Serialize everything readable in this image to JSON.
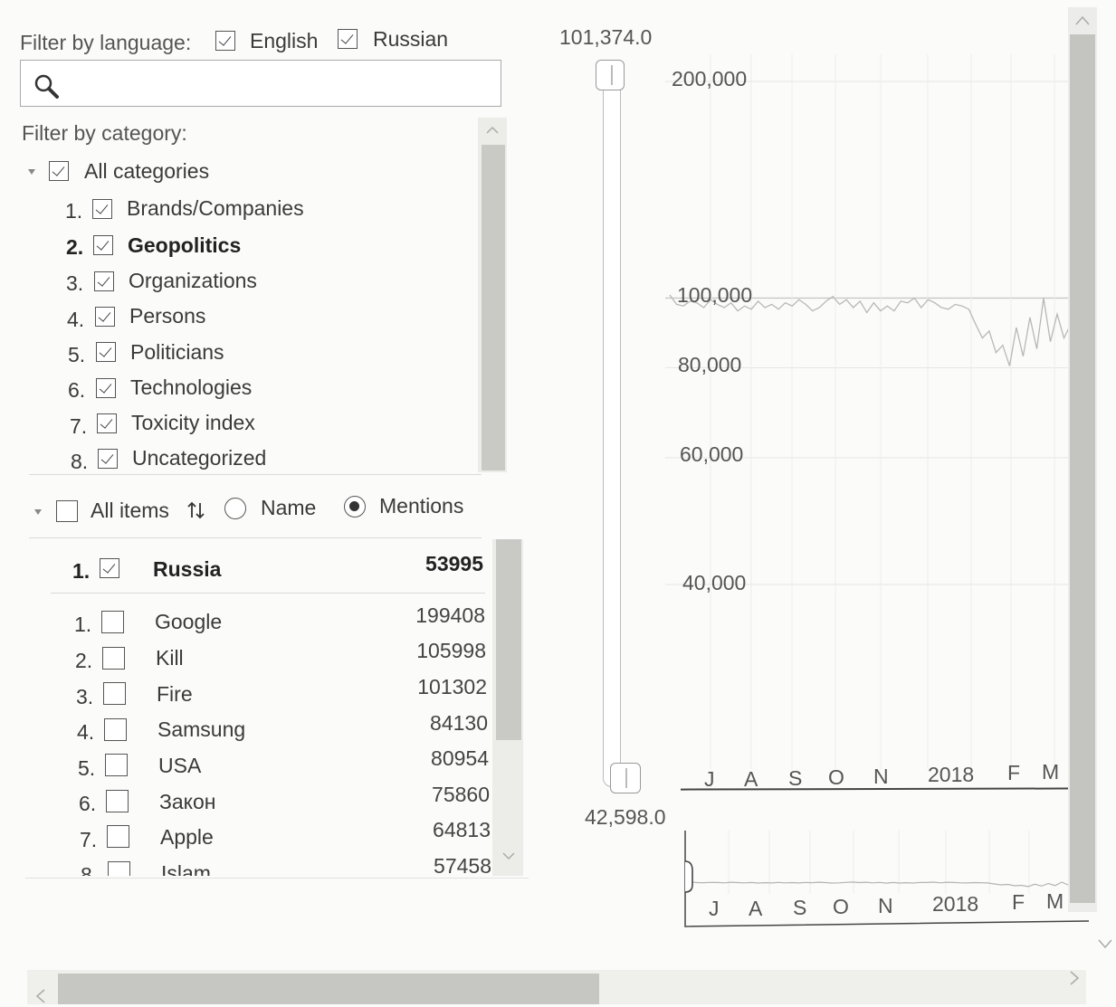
{
  "filters": {
    "language_label": "Filter by language:",
    "languages": [
      {
        "label": "English",
        "checked": true
      },
      {
        "label": "Russian",
        "checked": true
      }
    ],
    "search_placeholder": "",
    "category_label": "Filter by category:",
    "all_categories": {
      "label": "All categories",
      "checked": true
    },
    "categories": [
      {
        "num": "1.",
        "label": "Brands/Companies",
        "checked": true
      },
      {
        "num": "2.",
        "label": "Geopolitics",
        "checked": true,
        "bold": true
      },
      {
        "num": "3.",
        "label": "Organizations",
        "checked": true
      },
      {
        "num": "4.",
        "label": "Persons",
        "checked": true
      },
      {
        "num": "5.",
        "label": "Politicians",
        "checked": true
      },
      {
        "num": "6.",
        "label": "Technologies",
        "checked": true
      },
      {
        "num": "7.",
        "label": "Toxicity index",
        "checked": true
      },
      {
        "num": "8.",
        "label": "Uncategorized",
        "checked": true
      }
    ]
  },
  "items": {
    "all_items_label": "All items",
    "sort_icon": "sort-arrows-icon",
    "sort_options": [
      {
        "label": "Name",
        "selected": false
      },
      {
        "label": "Mentions",
        "selected": true
      }
    ],
    "pinned": {
      "num": "1.",
      "label": "Russia",
      "value": "53995",
      "checked": true
    },
    "rows": [
      {
        "num": "1.",
        "label": "Google",
        "value": "199408",
        "checked": false
      },
      {
        "num": "2.",
        "label": "Kill",
        "value": "105998",
        "checked": false
      },
      {
        "num": "3.",
        "label": "Fire",
        "value": "101302",
        "checked": false
      },
      {
        "num": "4.",
        "label": "Samsung",
        "value": "84130",
        "checked": false
      },
      {
        "num": "5.",
        "label": "USA",
        "value": "80954",
        "checked": false
      },
      {
        "num": "6.",
        "label": "Закон",
        "value": "75860",
        "checked": false
      },
      {
        "num": "7.",
        "label": "Apple",
        "value": "64813",
        "checked": false
      },
      {
        "num": "8.",
        "label": "Islam",
        "value": "57458",
        "checked": false
      }
    ]
  },
  "range_slider": {
    "max_label": "101,374.0",
    "min_label": "42,598.0"
  },
  "chart_data": {
    "type": "line",
    "y_scale": "log",
    "y_ticks": [
      "200,000",
      "100,000",
      "80,000",
      "60,000",
      "40,000"
    ],
    "y_tick_values": [
      200000,
      100000,
      80000,
      60000,
      40000
    ],
    "x_ticks": [
      "J",
      "A",
      "S",
      "O",
      "N",
      "2018",
      "F",
      "M"
    ],
    "ylim": [
      42598,
      101374
    ],
    "series": [
      {
        "values": [
          101000,
          98000,
          97500,
          99000,
          98500,
          97000,
          99500,
          98000,
          97000,
          98500,
          96000,
          97500,
          96500,
          99000,
          97000,
          98000,
          96500,
          98500,
          97500,
          99500,
          98000,
          96000,
          97000,
          99000,
          100500,
          98000,
          99500,
          97000,
          99000,
          95500,
          98500,
          96000,
          97500,
          96000,
          99000,
          98500,
          100000,
          97000,
          99500,
          98500,
          97000,
          96500,
          98000,
          97500,
          96500,
          92000,
          88000,
          90000,
          84000,
          86000,
          80500,
          91000,
          83000,
          94000,
          85000,
          100000,
          87000,
          95000,
          88000,
          92000
        ]
      }
    ],
    "grid": true
  },
  "navigator": {
    "x_ticks": [
      "J",
      "A",
      "S",
      "O",
      "N",
      "2018",
      "F",
      "M"
    ]
  },
  "scrollbars": {
    "up_icon": "chevron-up-icon",
    "down_icon": "chevron-down-icon",
    "left_icon": "chevron-left-icon",
    "right_icon": "chevron-right-icon"
  }
}
